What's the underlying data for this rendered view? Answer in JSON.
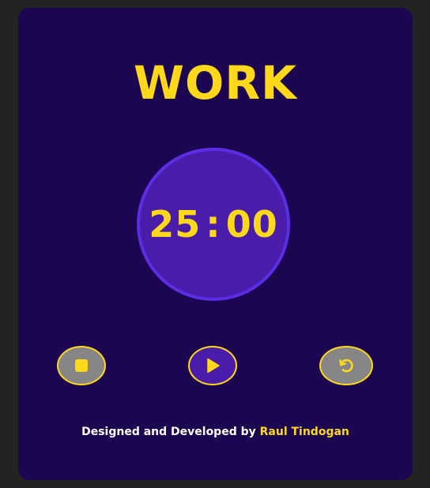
{
  "colors": {
    "background": "#232323",
    "card": "#1c0652",
    "accent": "#ffd919",
    "circle_fill": "#4a1caa",
    "circle_border": "#5b2ee6",
    "button_gray": "#868686"
  },
  "mode": {
    "title": "WORK"
  },
  "timer": {
    "minutes": "25",
    "separator": ":",
    "seconds": "00"
  },
  "controls": {
    "stop": {
      "icon": "stop-icon"
    },
    "play": {
      "icon": "play-icon"
    },
    "reset": {
      "icon": "reset-icon"
    }
  },
  "footer": {
    "prefix": "Designed and Developed by ",
    "author": "Raul Tindogan"
  }
}
